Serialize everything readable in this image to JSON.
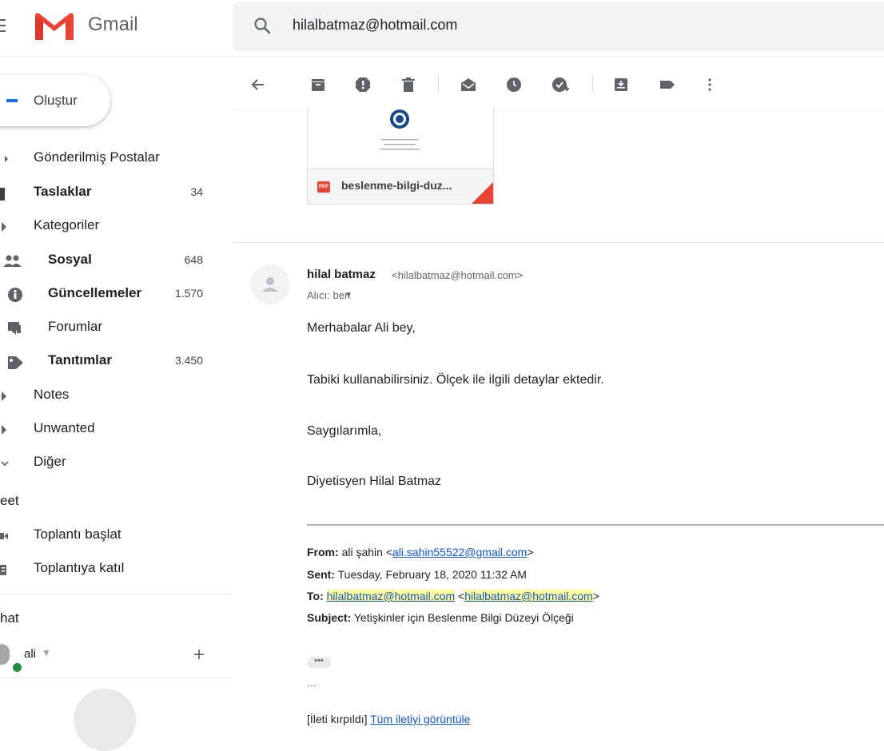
{
  "app": {
    "name": "Gmail"
  },
  "search": {
    "value": "hilalbatmaz@hotmail.com"
  },
  "compose": {
    "label": "Oluştur"
  },
  "sidebar": {
    "items": [
      {
        "label": "Gönderilmiş Postalar",
        "count": "",
        "bold": false,
        "icon": "chevron-right-icon"
      },
      {
        "label": "Taslaklar",
        "count": "34",
        "bold": true,
        "icon": "draft-icon"
      },
      {
        "label": "Kategoriler",
        "count": "",
        "bold": false,
        "icon": "expand-arrow-icon"
      },
      {
        "label": "Sosyal",
        "count": "648",
        "bold": true,
        "icon": "people-icon"
      },
      {
        "label": "Güncellemeler",
        "count": "1.570",
        "bold": true,
        "icon": "info-icon"
      },
      {
        "label": "Forumlar",
        "count": "",
        "bold": false,
        "icon": "forum-icon"
      },
      {
        "label": "Tanıtımlar",
        "count": "3.450",
        "bold": true,
        "icon": "tag-icon"
      },
      {
        "label": "Notes",
        "count": "",
        "bold": false,
        "icon": "label-icon"
      },
      {
        "label": "Unwanted",
        "count": "",
        "bold": false,
        "icon": "label-icon"
      },
      {
        "label": "Diğer",
        "count": "",
        "bold": false,
        "icon": "chevron-down-icon"
      }
    ],
    "meet": {
      "title": "eet",
      "start": "Toplantı başlat",
      "join": "Toplantıya katıl"
    },
    "chat": {
      "title": "hat",
      "user": "ali"
    }
  },
  "toolbar": {
    "icons": [
      "back-arrow-icon",
      "archive-icon",
      "report-spam-icon",
      "delete-icon",
      "mark-unread-icon",
      "snooze-icon",
      "add-task-icon",
      "move-to-icon",
      "labels-icon",
      "more-options-icon"
    ]
  },
  "attachment": {
    "filename": "beslenme-bilgi-duz...",
    "badge": "PDF"
  },
  "message": {
    "sender_name": "hilal batmaz",
    "sender_email": "<hilalbatmaz@hotmail.com>",
    "recipient": "Alıcı: ben",
    "body": [
      "Merhabalar Ali bey,",
      "Tabiki kullanabilirsiniz. Ölçek ile ilgili detaylar ektedir.",
      "Saygılarımla,",
      "Diyetisyen Hilal Batmaz"
    ],
    "quoted": {
      "from_label": "From:",
      "from_name": "ali şahin <",
      "from_email": "ali.sahin55522@gmail.com",
      "from_end": ">",
      "sent_label": "Sent:",
      "sent_value": "Tuesday, February 18, 2020 11:32 AM",
      "to_label": "To:",
      "to_email_1": "hilalbatmaz@hotmail.com",
      "to_email_2": "hilalbatmaz@hotmail.com",
      "subject_label": "Subject:",
      "subject_value": "Yetişkinler için Beslenme Bilgi Düzeyi Ölçeği"
    },
    "more": "•••",
    "ellipsis": "...",
    "clipped_prefix": "[İleti kırpıldı]",
    "clipped_link": "Tüm iletiyi görüntüle"
  }
}
